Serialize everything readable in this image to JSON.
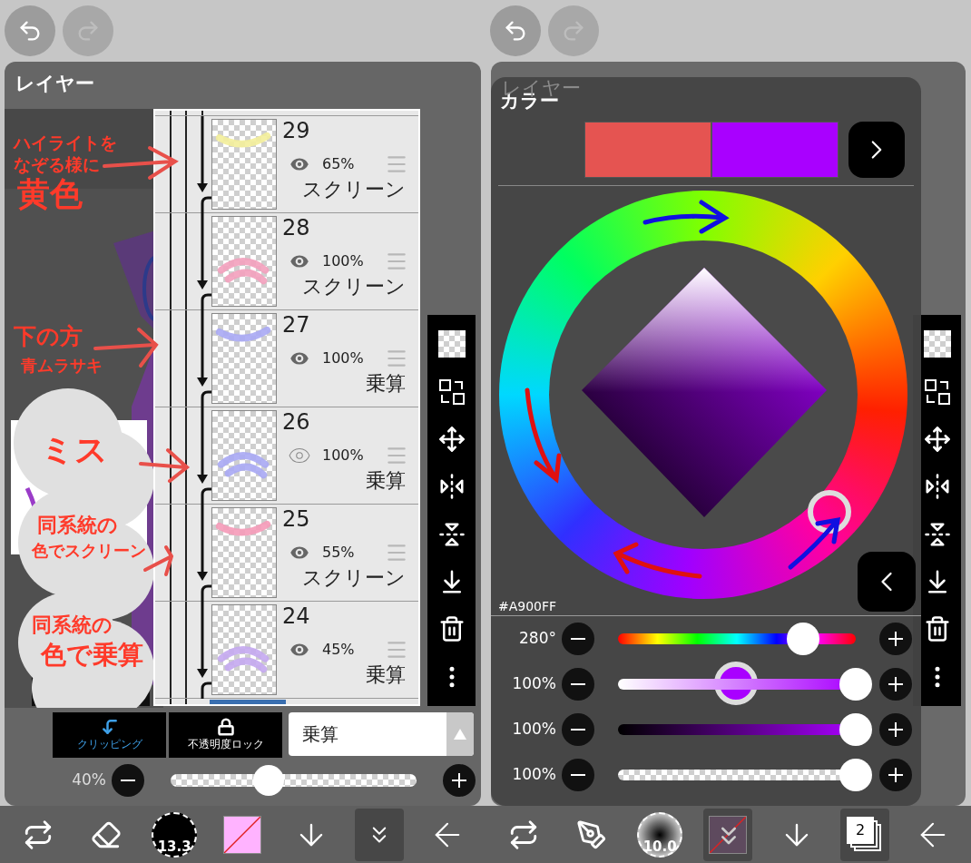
{
  "layer_panel": {
    "title": "レイヤー",
    "layers": [
      {
        "number": "29",
        "opacity": "65%",
        "blend": "スクリーン",
        "visible": true,
        "clipped": true,
        "color": "#f3ee9a"
      },
      {
        "number": "28",
        "opacity": "100%",
        "blend": "スクリーン",
        "visible": true,
        "clipped": true,
        "color": "#f3a0bc"
      },
      {
        "number": "27",
        "opacity": "100%",
        "blend": "乗算",
        "visible": true,
        "clipped": true,
        "color": "#a8a8f4"
      },
      {
        "number": "26",
        "opacity": "100%",
        "blend": "乗算",
        "visible": false,
        "clipped": true,
        "color": "#a8a8f4"
      },
      {
        "number": "25",
        "opacity": "55%",
        "blend": "スクリーン",
        "visible": true,
        "clipped": true,
        "color": "#f59ab8"
      },
      {
        "number": "24",
        "opacity": "45%",
        "blend": "乗算",
        "visible": true,
        "clipped": true,
        "color": "#c4a8f0"
      }
    ],
    "annotations": [
      "ハイライトを",
      "なぞる様に",
      "黄色",
      "下の方",
      "青ムラサキ",
      "ミス",
      "同系統の",
      "色でスクリーン",
      "同系統の",
      "色で乗算"
    ],
    "clipping": {
      "label": "クリッピング",
      "on": true
    },
    "alpha_lock": {
      "label": "不透明度ロック",
      "on": false
    },
    "blend_mode": "乗算",
    "opacity": {
      "reading": "40%",
      "level": 0.4
    }
  },
  "left_toolbar": [
    {
      "kind": "swap",
      "selected": false
    },
    {
      "kind": "eraser",
      "selected": false
    },
    {
      "kind": "brush",
      "label": "13.3",
      "selected": false
    },
    {
      "kind": "color",
      "color": "#ffb3ff",
      "selected": false
    },
    {
      "kind": "down",
      "selected": false
    },
    {
      "kind": "collapse",
      "selected": true
    },
    {
      "kind": "back",
      "selected": false
    }
  ],
  "color_panel": {
    "behind_title": "レイヤー",
    "title": "カラー",
    "swatches": [
      {
        "color": "#e55451"
      },
      {
        "color": "#a900ff"
      }
    ],
    "hex": "#A900FF",
    "sliders": [
      {
        "kind": "hue",
        "reading": "280°",
        "level": 0.78
      },
      {
        "kind": "saturation",
        "reading": "100%",
        "level": 1
      },
      {
        "kind": "brightness",
        "reading": "100%",
        "level": 1
      },
      {
        "kind": "alpha",
        "reading": "100%",
        "level": 1
      }
    ]
  },
  "right_toolbar": [
    {
      "kind": "swap",
      "selected": false
    },
    {
      "kind": "pen",
      "selected": false
    },
    {
      "kind": "brush",
      "label": "10.0",
      "selected": false
    },
    {
      "kind": "color",
      "color": "#5e4a5e",
      "selected": true
    },
    {
      "kind": "down",
      "selected": false
    },
    {
      "kind": "layers",
      "label": "2",
      "selected": true
    },
    {
      "kind": "back",
      "selected": false
    }
  ]
}
